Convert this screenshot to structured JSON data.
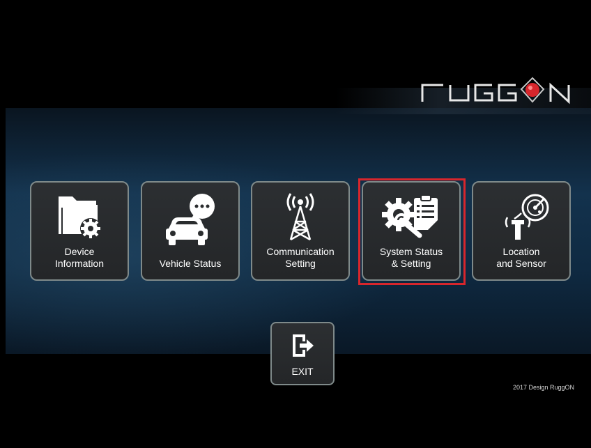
{
  "brand": {
    "logo_text": "RUGGON",
    "accent_color": "#d8262c"
  },
  "menu": {
    "items": [
      {
        "label": "Device\nInformation",
        "icon": "folder-gear-icon"
      },
      {
        "label": "Vehicle Status",
        "icon": "car-chat-icon"
      },
      {
        "label": "Communication\nSetting",
        "icon": "antenna-tower-icon"
      },
      {
        "label": "System Status\n& Setting",
        "icon": "gear-clipboard-icon",
        "selected": true
      },
      {
        "label": "Location\nand Sensor",
        "icon": "radar-sensor-icon"
      }
    ],
    "exit_label": "EXIT",
    "exit_icon": "exit-door-icon"
  },
  "footer": {
    "copyright": "2017 Design RuggON"
  },
  "colors": {
    "tile_border": "#7f8a8a",
    "tile_bg": "#2a2c2e",
    "highlight": "#d8262c"
  }
}
